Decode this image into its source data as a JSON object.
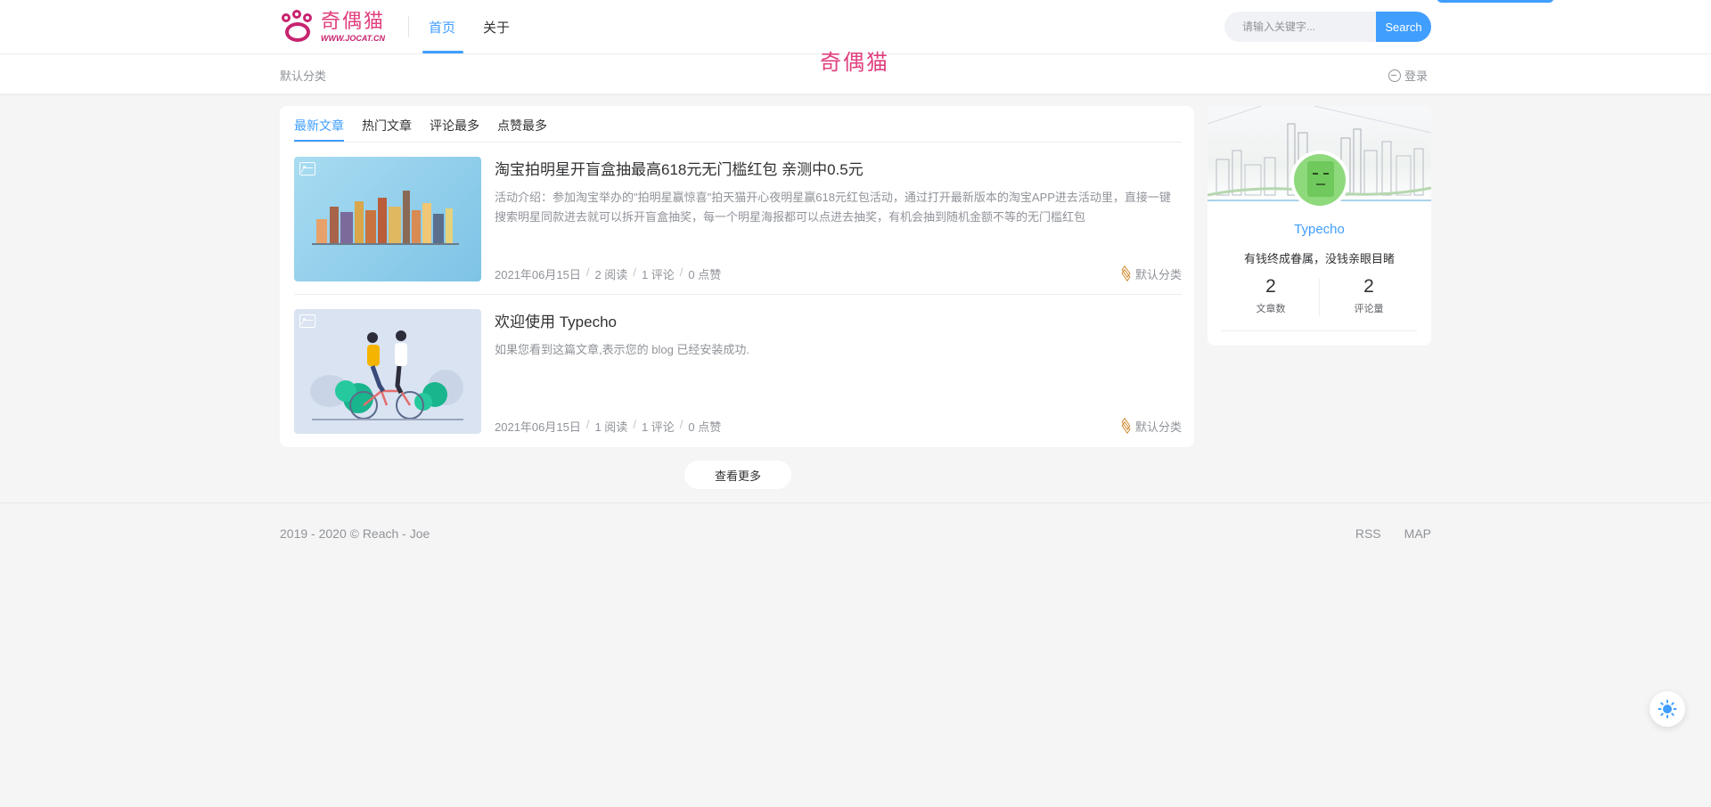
{
  "header": {
    "logo_text": "奇偶猫",
    "logo_url": "WWW.JOCAT.CN",
    "nav": [
      {
        "label": "首页",
        "active": true
      },
      {
        "label": "关于",
        "active": false
      }
    ],
    "search": {
      "placeholder": "请输入关键字...",
      "button_label": "Search"
    }
  },
  "subbar": {
    "category": "默认分类",
    "logo_text": "奇偶猫",
    "login_label": "登录"
  },
  "tabs": [
    "最新文章",
    "热门文章",
    "评论最多",
    "点赞最多"
  ],
  "posts": [
    {
      "title": "淘宝拍明星开盲盒抽最高618元无门槛红包 亲测中0.5元",
      "excerpt": "活动介绍：参加淘宝举办的\"拍明星赢惊喜\"拍天猫开心夜明星赢618元红包活动，通过打开最新版本的淘宝APP进去活动里，直接一键搜索明星同款进去就可以拆开盲盒抽奖，每一个明星海报都可以点进去抽奖，有机会抽到随机金额不等的无门槛红包",
      "date": "2021年06月15日",
      "reads": "2 阅读",
      "comments": "1 评论",
      "likes": "0 点赞",
      "category": "默认分类"
    },
    {
      "title": "欢迎使用 Typecho",
      "excerpt": "如果您看到这篇文章,表示您的 blog 已经安装成功.",
      "date": "2021年06月15日",
      "reads": "1 阅读",
      "comments": "1 评论",
      "likes": "0 点赞",
      "category": "默认分类"
    }
  ],
  "more_button": "查看更多",
  "sidebar": {
    "name": "Typecho",
    "motto": "有钱终成眷属，没钱亲眼目睹",
    "stats": [
      {
        "value": "2",
        "label": "文章数"
      },
      {
        "value": "2",
        "label": "评论量"
      }
    ]
  },
  "footer": {
    "copyright": "2019 - 2020 © Reach - Joe",
    "links": [
      "RSS",
      "MAP"
    ]
  },
  "colors": {
    "accent": "#409eff",
    "brand": "#e0407f",
    "background": "#f5f5f5"
  },
  "icons": [
    "image-icon",
    "layers-icon",
    "login-icon",
    "sun-icon"
  ]
}
